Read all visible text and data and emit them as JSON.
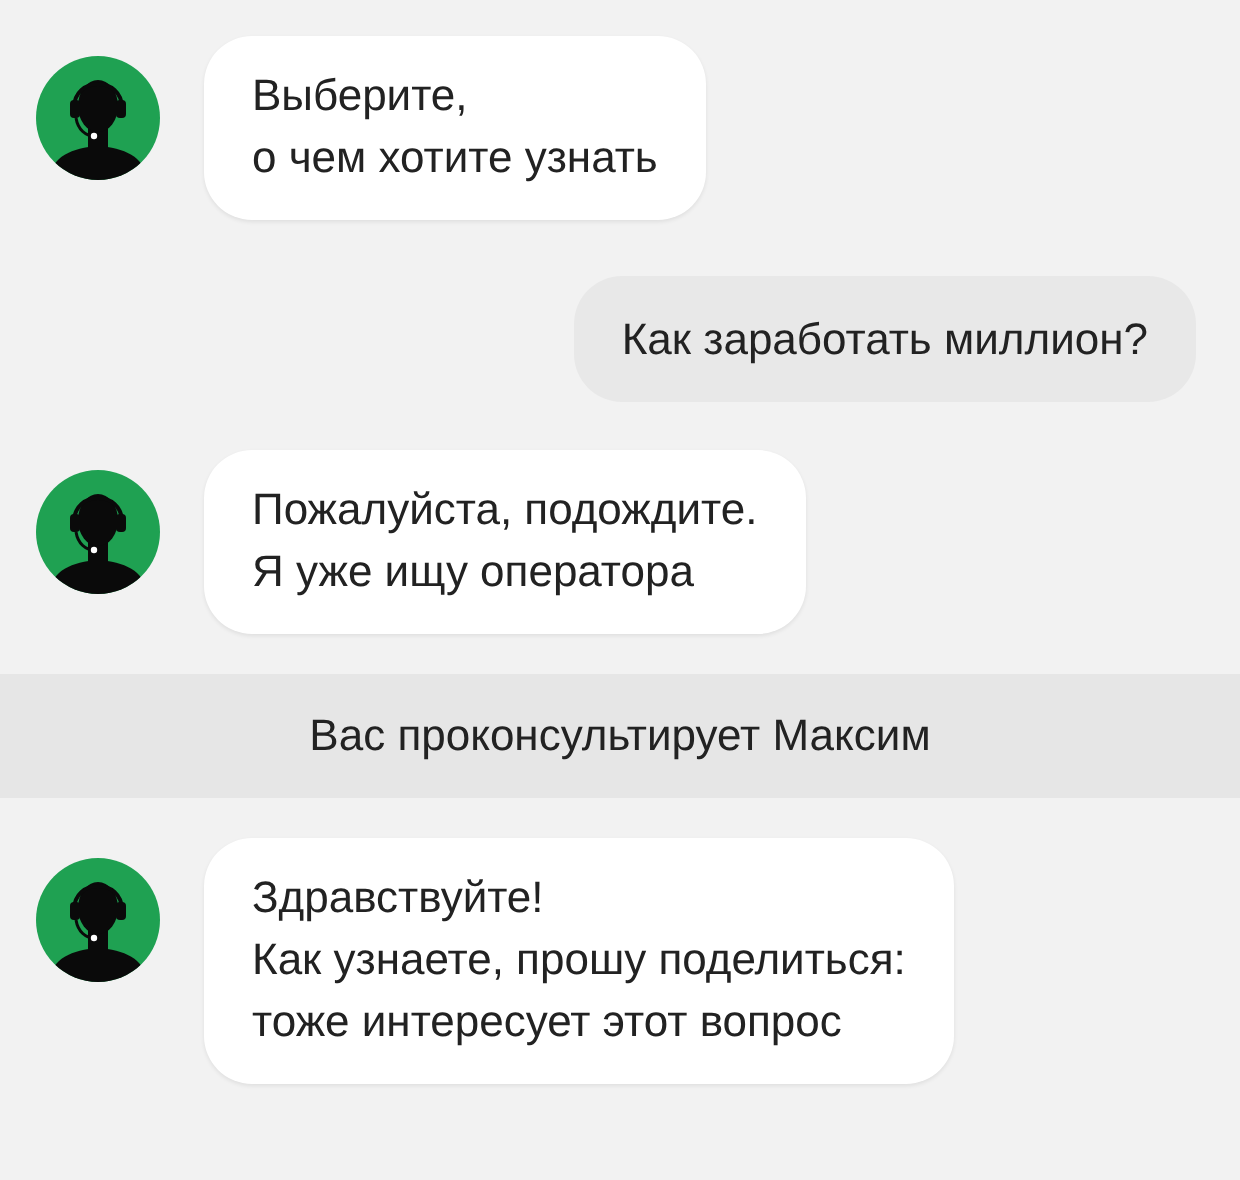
{
  "messages": [
    {
      "kind": "agent",
      "text": "Выберите,\nо чем хотите узнать"
    },
    {
      "kind": "user",
      "text": "Как заработать миллион?"
    },
    {
      "kind": "agent",
      "text": "Пожалуйста, подождите.\nЯ уже ищу оператора"
    },
    {
      "kind": "notice",
      "text": "Вас проконсультирует Максим"
    },
    {
      "kind": "agent",
      "text": "Здравствуйте!\nКак узнаете, прошу поделиться:\nтоже интересует этот вопрос"
    }
  ]
}
